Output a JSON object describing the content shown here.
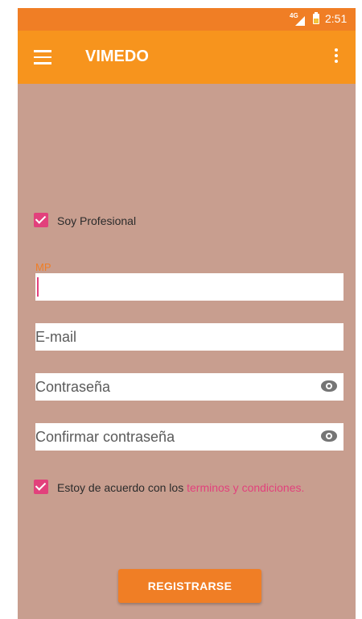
{
  "status_bar": {
    "network": "4G",
    "time": "2:51"
  },
  "app_bar": {
    "title": "VIMEDO"
  },
  "form": {
    "professional_label": "Soy Profesional",
    "mp_label": "MP",
    "mp_value": "",
    "email_placeholder": "E-mail",
    "password_placeholder": "Contraseña",
    "confirm_password_placeholder": "Confirmar contraseña",
    "terms_prefix": "Estoy de acuerdo con los ",
    "terms_link": "terminos y condiciones."
  },
  "register_button": "REGISTRARSE",
  "colors": {
    "primary": "#f7941d",
    "status": "#f07e25",
    "accent": "#e2417c",
    "background": "#c89e8f"
  },
  "icons": [
    "menu-icon",
    "more-vert-icon",
    "eye-icon",
    "check-icon",
    "signal-icon",
    "battery-icon"
  ]
}
